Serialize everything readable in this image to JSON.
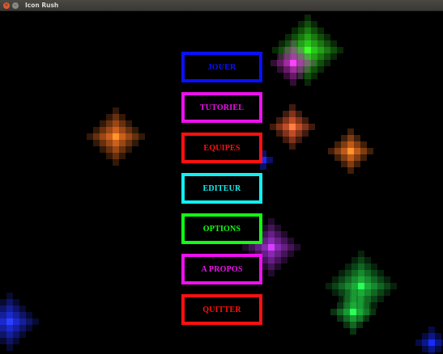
{
  "window": {
    "title": "Icon Rush"
  },
  "menu": {
    "buttons": [
      {
        "label": "JOUER",
        "color": "#0a10ff",
        "name": "play-button"
      },
      {
        "label": "TUTORIEL",
        "color": "#ee10ee",
        "name": "tutorial-button"
      },
      {
        "label": "EQUIPES",
        "color": "#ff1010",
        "name": "teams-button"
      },
      {
        "label": "EDITEUR",
        "color": "#10f0f0",
        "name": "editor-button"
      },
      {
        "label": "OPTIONS",
        "color": "#10ff10",
        "name": "options-button"
      },
      {
        "label": "A PROPOS",
        "color": "#ee10ee",
        "name": "about-button"
      },
      {
        "label": "QUITTER",
        "color": "#ff1010",
        "name": "quit-button"
      }
    ]
  },
  "background": {
    "particle_colors": [
      "#33ee22",
      "#cc33cc",
      "#ff7722",
      "#ff6633",
      "#aa33dd",
      "#2233ff",
      "#22cc44",
      "#1122cc"
    ]
  }
}
